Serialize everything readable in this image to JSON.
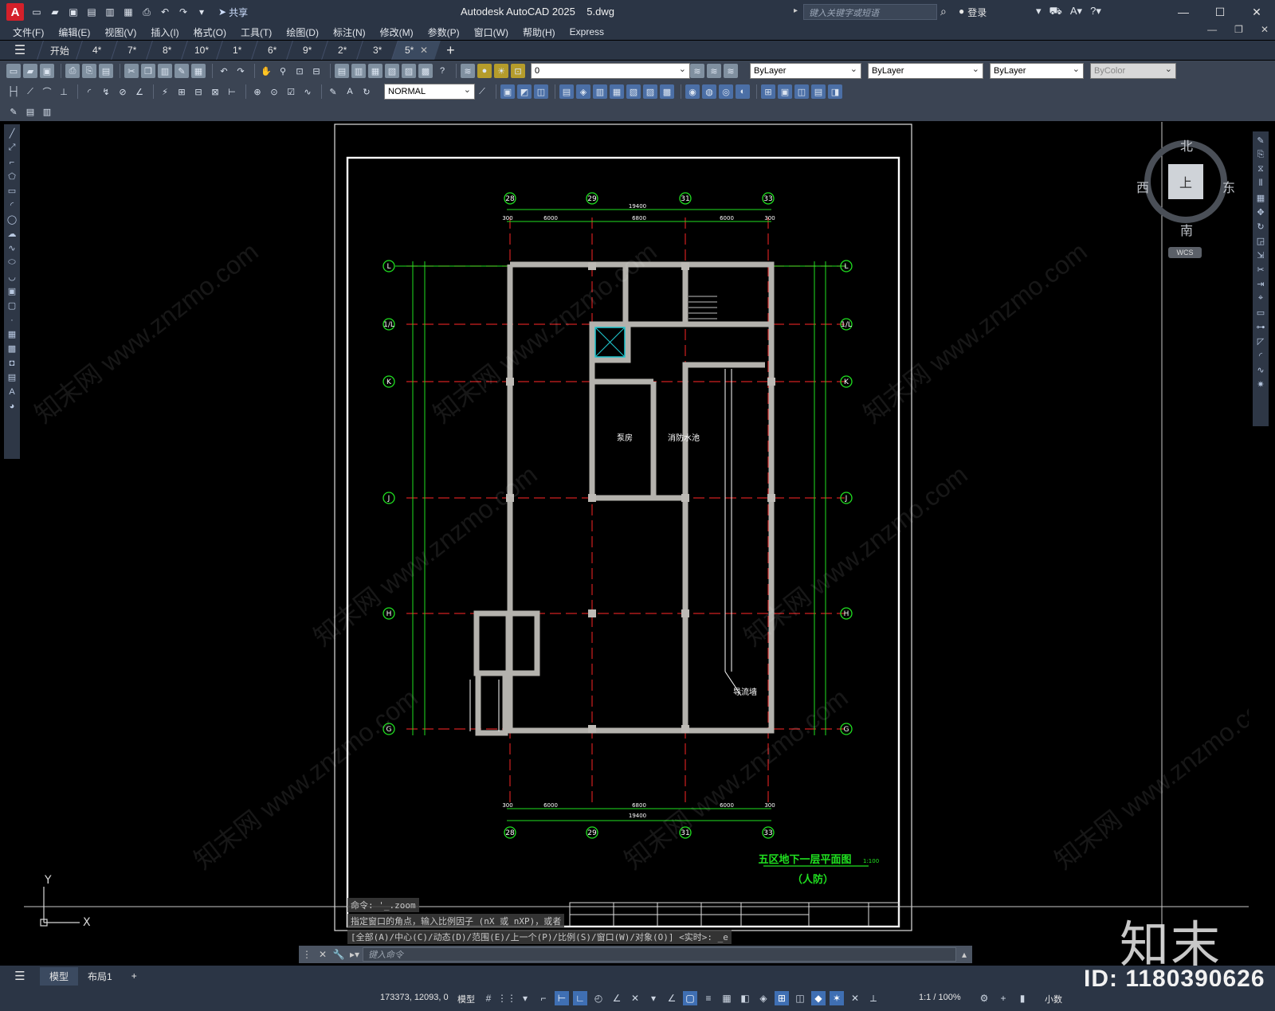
{
  "titlebar": {
    "logo": "A",
    "share": "共享",
    "title": "Autodesk AutoCAD 2025",
    "filename": "5.dwg",
    "search_placeholder": "键入关键字或短语",
    "login": "登录"
  },
  "menu": [
    "文件(F)",
    "编辑(E)",
    "视图(V)",
    "插入(I)",
    "格式(O)",
    "工具(T)",
    "绘图(D)",
    "标注(N)",
    "修改(M)",
    "参数(P)",
    "窗口(W)",
    "帮助(H)",
    "Express"
  ],
  "file_tabs": [
    "开始",
    "4*",
    "7*",
    "8*",
    "10*",
    "1*",
    "6*",
    "9*",
    "2*",
    "3*",
    "5*"
  ],
  "active_tab": "5*",
  "toolbar": {
    "layer": "0",
    "color": "ByLayer",
    "linetype": "ByLayer",
    "lineweight": "ByLayer",
    "plotstyle": "ByColor",
    "dimstyle": "NORMAL"
  },
  "viewcube": {
    "north": "北",
    "south": "南",
    "east": "东",
    "west": "西",
    "top": "上",
    "wcs": "WCS"
  },
  "drawing": {
    "grid_top": [
      "28",
      "29",
      "31",
      "33"
    ],
    "grid_side": [
      "L",
      "1/L",
      "K",
      "J",
      "H",
      "G"
    ],
    "dims_top_total": "19400",
    "dims_top": [
      "300",
      "6000",
      "6800",
      "6000",
      "300"
    ],
    "rooms": [
      "泵房",
      "消防水池",
      "导流墙"
    ],
    "title": "五区地下一层平面图",
    "scale": "1:100",
    "subtitle": "（人防）"
  },
  "command": {
    "history": [
      "命令: '_.zoom",
      "指定窗口的角点，输入比例因子 (nX 或 nXP)，或者",
      "[全部(A)/中心(C)/动态(D)/范围(E)/上一个(P)/比例(S)/窗口(W)/对象(O)] <实时>: _e"
    ],
    "placeholder": "键入命令"
  },
  "layout_tabs": [
    "模型",
    "布局1"
  ],
  "status": {
    "coords": "173373, 12093, 0",
    "model": "模型",
    "scale": "1:1 / 100%",
    "units": "小数"
  },
  "watermark": {
    "id": "ID: 1180390626",
    "brand": "知末",
    "text": "知末网 www.znzmo.com"
  }
}
